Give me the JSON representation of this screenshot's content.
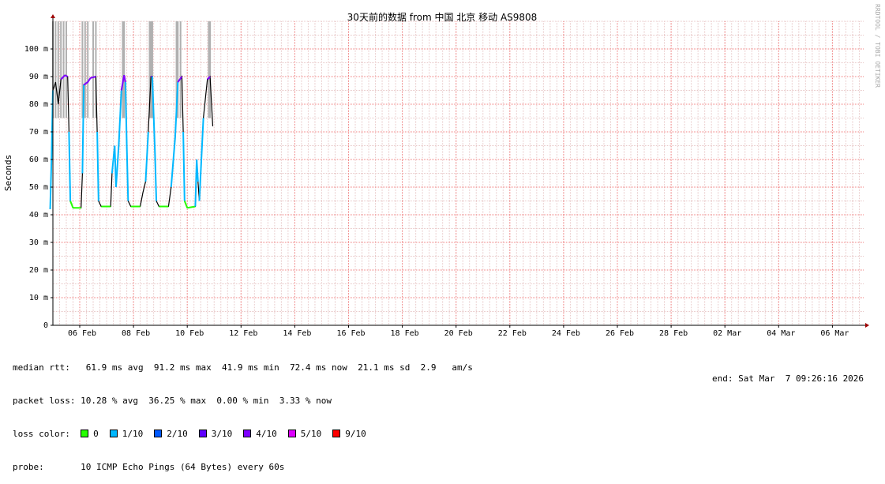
{
  "chart_data": {
    "type": "line",
    "title": "30天前的数据 from  中国 北京 移动 AS9808",
    "ylabel": "Seconds",
    "ylim": [
      0,
      110
    ],
    "y_tick_labels": [
      "0",
      "10 m",
      "20 m",
      "30 m",
      "40 m",
      "50 m",
      "60 m",
      "70 m",
      "80 m",
      "90 m",
      "100 m"
    ],
    "x_tick_labels": [
      "06 Feb",
      "08 Feb",
      "10 Feb",
      "12 Feb",
      "14 Feb",
      "16 Feb",
      "18 Feb",
      "20 Feb",
      "22 Feb",
      "24 Feb",
      "26 Feb",
      "28 Feb",
      "02 Mar",
      "04 Mar",
      "06 Mar"
    ],
    "x_unit": "days since 2026-02-05 00:00",
    "grid": true,
    "series": [
      {
        "name": "median rtt",
        "points": [
          [
            -0.1,
            42
          ],
          [
            -0.05,
            60
          ],
          [
            0.0,
            85
          ],
          [
            0.1,
            88
          ],
          [
            0.2,
            80
          ],
          [
            0.3,
            89
          ],
          [
            0.45,
            90.5
          ],
          [
            0.55,
            90
          ],
          [
            0.6,
            70
          ],
          [
            0.65,
            45
          ],
          [
            0.75,
            42.5
          ],
          [
            1.05,
            42.5
          ],
          [
            1.1,
            55
          ],
          [
            1.15,
            87
          ],
          [
            1.3,
            88
          ],
          [
            1.4,
            89.5
          ],
          [
            1.6,
            90
          ],
          [
            1.65,
            70
          ],
          [
            1.7,
            45
          ],
          [
            1.8,
            43
          ],
          [
            2.15,
            43
          ],
          [
            2.2,
            55
          ],
          [
            2.3,
            65
          ],
          [
            2.35,
            50
          ],
          [
            2.45,
            65
          ],
          [
            2.55,
            85
          ],
          [
            2.65,
            90.5
          ],
          [
            2.7,
            88
          ],
          [
            2.75,
            65
          ],
          [
            2.8,
            45
          ],
          [
            2.9,
            43
          ],
          [
            3.25,
            43
          ],
          [
            3.35,
            48
          ],
          [
            3.45,
            52
          ],
          [
            3.55,
            70
          ],
          [
            3.65,
            90
          ],
          [
            3.7,
            90
          ],
          [
            3.8,
            62
          ],
          [
            3.85,
            45
          ],
          [
            3.95,
            43
          ],
          [
            4.3,
            43
          ],
          [
            4.4,
            50
          ],
          [
            4.55,
            68
          ],
          [
            4.65,
            88
          ],
          [
            4.8,
            90
          ],
          [
            4.85,
            70
          ],
          [
            4.9,
            45
          ],
          [
            5.0,
            42.5
          ],
          [
            5.3,
            43
          ],
          [
            5.35,
            60
          ],
          [
            5.4,
            52
          ],
          [
            5.45,
            45
          ],
          [
            5.6,
            75
          ],
          [
            5.75,
            89
          ],
          [
            5.85,
            90
          ],
          [
            5.95,
            72
          ]
        ]
      }
    ],
    "loss_spikes_days": [
      0.0,
      0.1,
      0.2,
      0.3,
      0.4,
      0.5,
      1.1,
      1.2,
      1.3,
      1.5,
      1.6,
      2.6,
      2.65,
      3.6,
      3.65,
      3.7,
      4.6,
      4.65,
      4.75,
      5.8,
      5.85
    ],
    "median_rtt": {
      "label": "median rtt:",
      "avg": "61.9 ms avg",
      "max": "91.2 ms max",
      "min": "41.9 ms min",
      "now": "72.4 ms now",
      "sd": "21.1 ms sd",
      "ams": "2.9   am/s"
    },
    "packet_loss": {
      "label": "packet loss:",
      "avg": "10.28 % avg",
      "max": "36.25 % max",
      "min": "0.00 % min",
      "now": "3.33 % now"
    },
    "loss_colors": [
      {
        "label": "0",
        "color": "#26ff00"
      },
      {
        "label": "1/10",
        "color": "#00b8ff"
      },
      {
        "label": "2/10",
        "color": "#0059ff"
      },
      {
        "label": "3/10",
        "color": "#5e00ff"
      },
      {
        "label": "4/10",
        "color": "#7e00ff"
      },
      {
        "label": "5/10",
        "color": "#dd00ff"
      },
      {
        "label": "9/10",
        "color": "#ff0000"
      }
    ],
    "loss_color_label": "loss color:",
    "probe_label": "probe:",
    "probe_text": "10 ICMP Echo Pings (64 Bytes) every 60s",
    "end_text": "end: Sat Mar  7 09:26:16 2026",
    "watermark": "RRDTOOL / TOBI OETIKER"
  }
}
